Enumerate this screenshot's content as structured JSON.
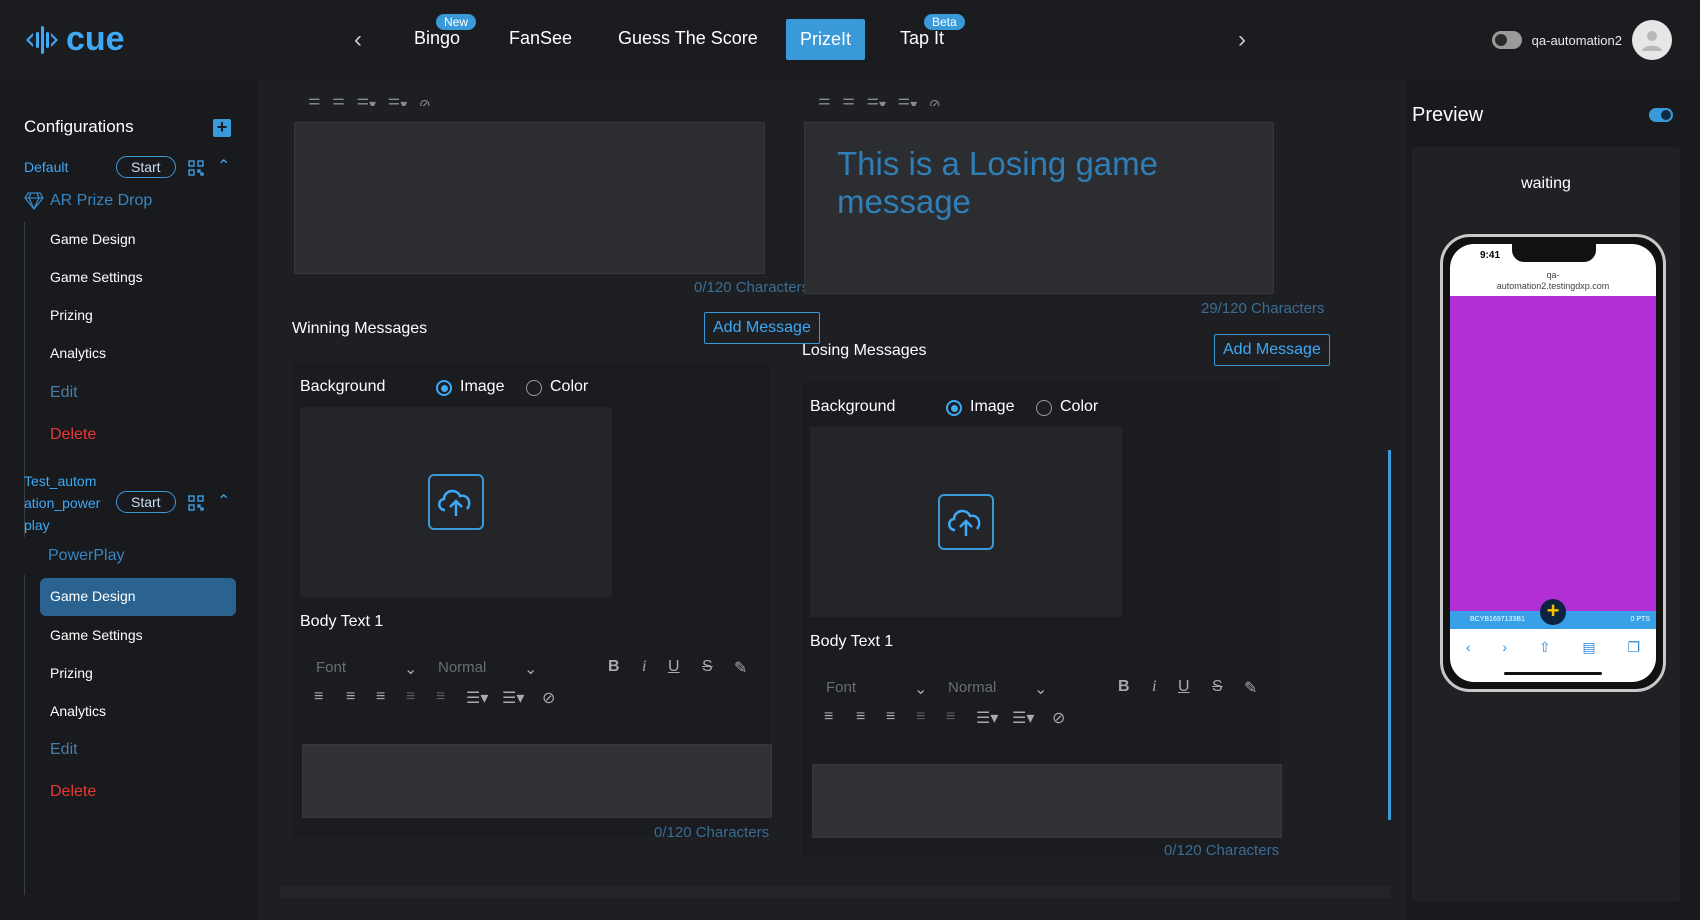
{
  "app": {
    "logo_text": "cue"
  },
  "tabs": [
    {
      "label": "Bingo",
      "badge": "New"
    },
    {
      "label": "FanSee"
    },
    {
      "label": "Guess The Score"
    },
    {
      "label": "PrizeIt",
      "active": true
    },
    {
      "label": "Tap It",
      "badge": "Beta"
    }
  ],
  "user": {
    "name": "qa-automation2"
  },
  "sidebar": {
    "title": "Configurations",
    "configs": [
      {
        "name": "Default",
        "start_label": "Start",
        "game_type": "AR Prize Drop",
        "items": [
          "Game Design",
          "Game Settings",
          "Prizing",
          "Analytics",
          "Edit",
          "Delete"
        ]
      },
      {
        "name_lines": [
          "Test_autom",
          "ation_power",
          "play"
        ],
        "start_label": "Start",
        "game_type": "PowerPlay",
        "items": [
          "Game Design",
          "Game Settings",
          "Prizing",
          "Analytics",
          "Edit",
          "Delete"
        ],
        "selected": "Game Design"
      }
    ]
  },
  "main": {
    "left": {
      "char_count_top": "0/120 Characters",
      "section_title": "Winning Messages",
      "add_label": "Add Message",
      "background_label": "Background",
      "option_image": "Image",
      "option_color": "Color",
      "body_title": "Body Text 1",
      "font_placeholder": "Font",
      "size_placeholder": "Normal",
      "char_count_body": "0/120 Characters"
    },
    "right": {
      "message_text": "This is a Losing game message",
      "char_count_top": "29/120 Characters",
      "section_title": "Losing Messages",
      "add_label": "Add Message",
      "background_label": "Background",
      "option_image": "Image",
      "option_color": "Color",
      "body_title": "Body Text 1",
      "font_placeholder": "Font",
      "size_placeholder": "Normal",
      "char_count_body": "0/120 Characters"
    }
  },
  "preview": {
    "title": "Preview",
    "status": "waiting",
    "phone_time": "9:41",
    "phone_url_line1": "qa-",
    "phone_url_line2": "automation2.testingdxp.com",
    "phone_bar_left": "BCYB1697133B1",
    "phone_bar_right": "0 PTS"
  },
  "colors": {
    "accent": "#3a9ad9",
    "danger": "#e53935",
    "purple_screen": "#b12fd4"
  }
}
